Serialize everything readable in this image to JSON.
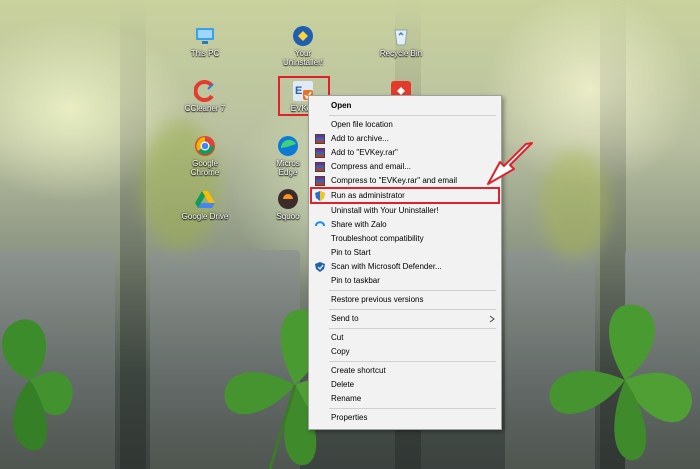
{
  "desktop_icons": [
    {
      "label": "This PC",
      "icon": "computer-icon"
    },
    {
      "label": "Your Uninstaller!",
      "icon": "uninstaller-icon"
    },
    {
      "label": "Recycle Bin",
      "icon": "recycle-bin-icon"
    },
    {
      "label": "CCleaner 7",
      "icon": "ccleaner-icon"
    },
    {
      "label": "EVKey",
      "icon": "evkey-icon"
    },
    {
      "label": "Google Chrome",
      "icon": "chrome-icon"
    },
    {
      "label": "Microsoft Edge",
      "icon": "edge-icon"
    },
    {
      "label": "Google Drive",
      "icon": "google-drive-icon"
    },
    {
      "label": "Squoosh",
      "icon": "squoosh-icon"
    }
  ],
  "labels": {
    "this_pc": "This PC",
    "uninstaller_1": "Your",
    "uninstaller_2": "Uninstaller!",
    "recycle": "Recycle Bin",
    "ccleaner": "CCleaner 7",
    "evkey": "EVKey",
    "chrome_1": "Google",
    "chrome_2": "Chrome",
    "edge_1": "Micros",
    "edge_2": "Edge",
    "drive": "Google Drive",
    "squoosh": "Squoo"
  },
  "context_menu": {
    "open": "Open",
    "open_file_location": "Open file location",
    "add_to_archive": "Add to archive...",
    "add_to_rar": "Add to \"EVKey.rar\"",
    "compress_email": "Compress and email...",
    "compress_rar_email": "Compress to \"EVKey.rar\" and email",
    "run_as_admin": "Run as administrator",
    "uninstall_with": "Uninstall with Your Uninstaller!",
    "share_zalo": "Share with Zalo",
    "troubleshoot": "Troubleshoot compatibility",
    "pin_start": "Pin to Start",
    "scan_defender": "Scan with Microsoft Defender...",
    "pin_taskbar": "Pin to taskbar",
    "restore_versions": "Restore previous versions",
    "send_to": "Send to",
    "cut": "Cut",
    "copy": "Copy",
    "create_shortcut": "Create shortcut",
    "delete": "Delete",
    "rename": "Rename",
    "properties": "Properties"
  },
  "colors": {
    "highlight": "#e2202a",
    "menu_bg": "#f2f2f2"
  }
}
